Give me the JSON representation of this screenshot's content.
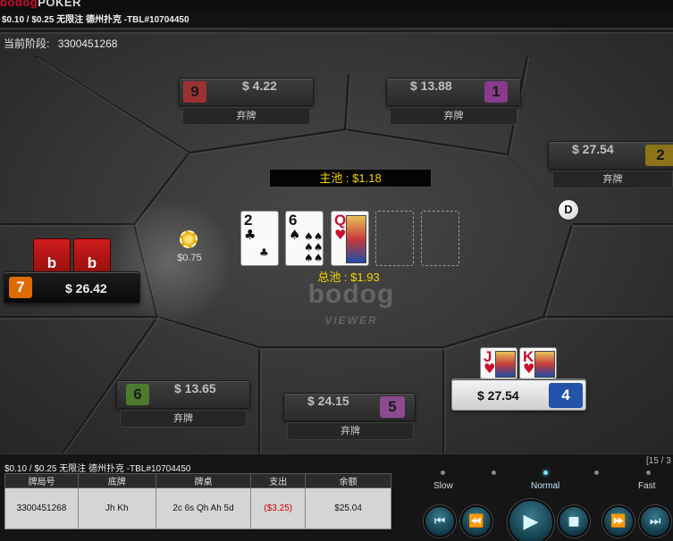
{
  "app": {
    "logo_brand": "bodog",
    "logo_suffix": "POKER",
    "window_title": "$0.10 / $0.25 无限注 德州扑克 -TBL#10704450",
    "stage_label": "当前阶段:",
    "hand_id": "3300451268"
  },
  "seats": [
    {
      "num": "9",
      "amount": "$ 4.22",
      "status": "弃牌",
      "color": "#9b3232"
    },
    {
      "num": "1",
      "amount": "$ 13.88",
      "status": "弃牌",
      "color": "#8a3a8a"
    },
    {
      "num": "2",
      "amount": "$ 27.54",
      "status": "弃牌",
      "color": "#8c7418"
    },
    {
      "num": "7",
      "amount": "$ 26.42",
      "status": "",
      "color": "#e06a00"
    },
    {
      "num": "6",
      "amount": "$ 13.65",
      "status": "弃牌",
      "color": "#4d7a2e"
    },
    {
      "num": "5",
      "amount": "$ 24.15",
      "status": "弃牌",
      "color": "#8c4a92"
    },
    {
      "num": "4",
      "amount": "$ 27.54",
      "status": "",
      "color": "#2352a8"
    }
  ],
  "pot": {
    "main": "主池 : $1.18",
    "total": "总池 : $1.93"
  },
  "board": [
    {
      "rank": "2",
      "suit": "♣",
      "color": "black"
    },
    {
      "rank": "6",
      "suit": "♠",
      "color": "black"
    },
    {
      "rank": "Q",
      "suit": "♥",
      "color": "red"
    }
  ],
  "hero_cards": [
    {
      "rank": "J",
      "suit": "♥"
    },
    {
      "rank": "K",
      "suit": "♥"
    }
  ],
  "bet": "$0.75",
  "dealer_button": "D",
  "watermark": {
    "brand": "bodog",
    "sub": "VIEWER"
  },
  "history": {
    "title": "$0.10 / $0.25 无限注 德州扑克 -TBL#10704450",
    "headers": [
      "牌局号",
      "底牌",
      "牌桌",
      "支出",
      "余额"
    ],
    "row": [
      "3300451268",
      "Jh Kh",
      "2c 6s Qh Ah 5d",
      "($3.25)",
      "$25.04"
    ]
  },
  "pager": "[15 / 3",
  "speed": {
    "slow": "Slow",
    "normal": "Normal",
    "fast": "Fast",
    "selected": "Normal"
  },
  "controls": {
    "first": "⏮",
    "rewind": "⏪",
    "play": "▶",
    "stop": "■",
    "forward": "⏩",
    "last": "⏭"
  }
}
